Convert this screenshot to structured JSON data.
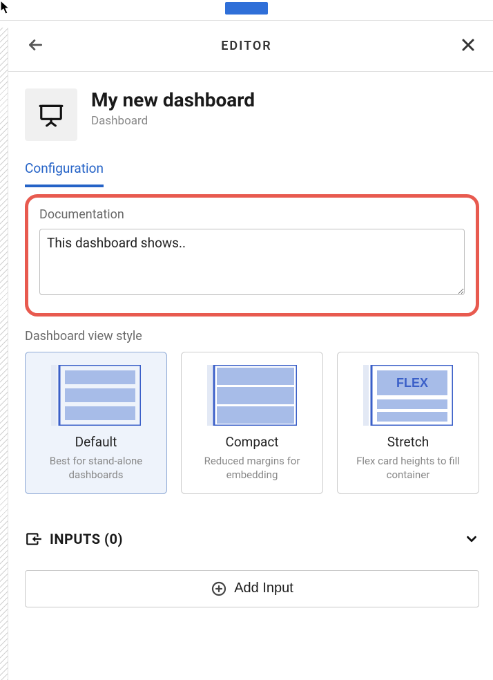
{
  "header": {
    "title": "EDITOR"
  },
  "dashboard": {
    "title": "My new dashboard",
    "subtitle": "Dashboard"
  },
  "tabs": {
    "configuration": "Configuration"
  },
  "documentation": {
    "label": "Documentation",
    "value": "This dashboard shows.."
  },
  "viewStyle": {
    "label": "Dashboard view style",
    "options": [
      {
        "title": "Default",
        "desc": "Best for stand-alone dashboards",
        "selected": true
      },
      {
        "title": "Compact",
        "desc": "Reduced margins for embedding",
        "selected": false
      },
      {
        "title": "Stretch",
        "desc": "Flex card heights to fill container",
        "selected": false,
        "flex_label": "FLEX"
      }
    ]
  },
  "inputs": {
    "title": "INPUTS (0)",
    "add_label": "Add Input"
  }
}
